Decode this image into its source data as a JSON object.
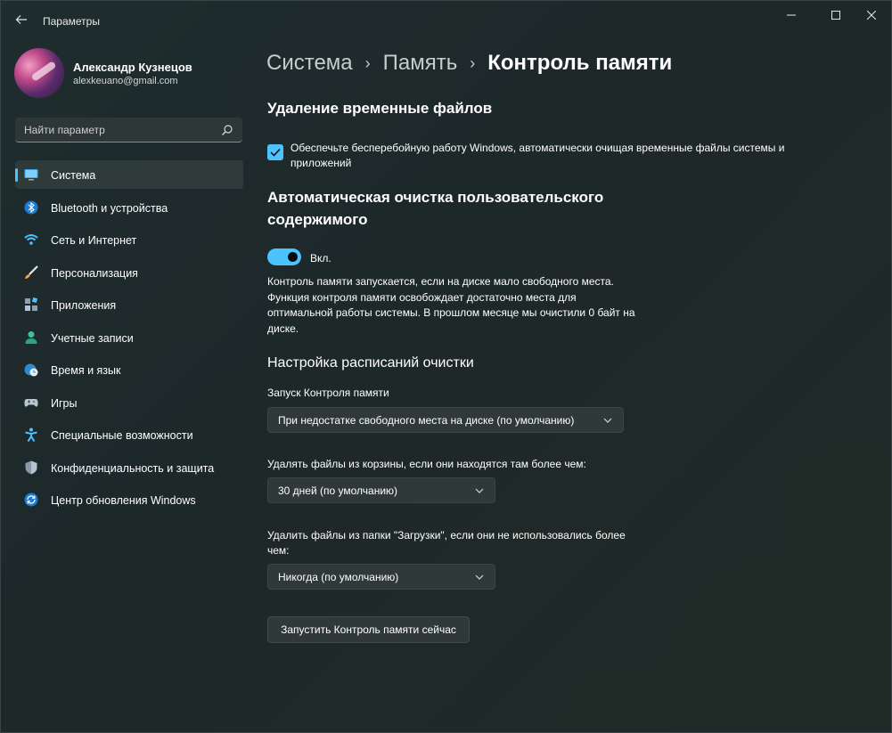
{
  "window": {
    "title": "Параметры"
  },
  "profile": {
    "name": "Александр Кузнецов",
    "email": "alexkeuano@gmail.com"
  },
  "search": {
    "placeholder": "Найти параметр"
  },
  "sidebar": {
    "items": [
      {
        "label": "Система",
        "icon": "monitor-icon",
        "active": true
      },
      {
        "label": "Bluetooth и устройства",
        "icon": "bluetooth-icon"
      },
      {
        "label": "Сеть и Интернет",
        "icon": "wifi-icon"
      },
      {
        "label": "Персонализация",
        "icon": "brush-icon"
      },
      {
        "label": "Приложения",
        "icon": "apps-icon"
      },
      {
        "label": "Учетные записи",
        "icon": "person-icon"
      },
      {
        "label": "Время и язык",
        "icon": "globe-clock-icon"
      },
      {
        "label": "Игры",
        "icon": "gamepad-icon"
      },
      {
        "label": "Специальные возможности",
        "icon": "accessibility-icon"
      },
      {
        "label": "Конфиденциальность и защита",
        "icon": "shield-icon"
      },
      {
        "label": "Центр обновления Windows",
        "icon": "update-icon"
      }
    ]
  },
  "breadcrumb": {
    "part1": "Система",
    "part2": "Память",
    "current": "Контроль памяти"
  },
  "main": {
    "temp_heading": "Удаление временные файлов",
    "temp_checkbox_label": "Обеспечьте бесперебойную работу Windows, автоматически очищая временные файлы системы и приложений",
    "temp_checkbox_checked": true,
    "auto_heading_line1": "Автоматическая очистка пользовательского",
    "auto_heading_line2": "содержимого",
    "toggle_label": "Вкл.",
    "toggle_on": true,
    "description": "Контроль памяти запускается, если на диске мало свободного места. Функция контроля памяти освобождает достаточно места для оптимальной работы системы. В прошлом месяце мы очистили 0 байт на диске.",
    "schedule_heading": "Настройка расписаний очистки",
    "run_label": "Запуск Контроля памяти",
    "run_value": "При недостатке свободного места на диске (по умолчанию)",
    "recycle_label": "Удалять файлы из корзины, если они находятся там более чем:",
    "recycle_value": "30 дней (по умолчанию)",
    "downloads_label": "Удалить файлы из папки \"Загрузки\", если они не использовались более чем:",
    "downloads_value": "Никогда (по умолчанию)",
    "run_now_button": "Запустить Контроль памяти сейчас"
  },
  "colors": {
    "accent": "#4cc2ff",
    "background": "#1f2b2b"
  }
}
